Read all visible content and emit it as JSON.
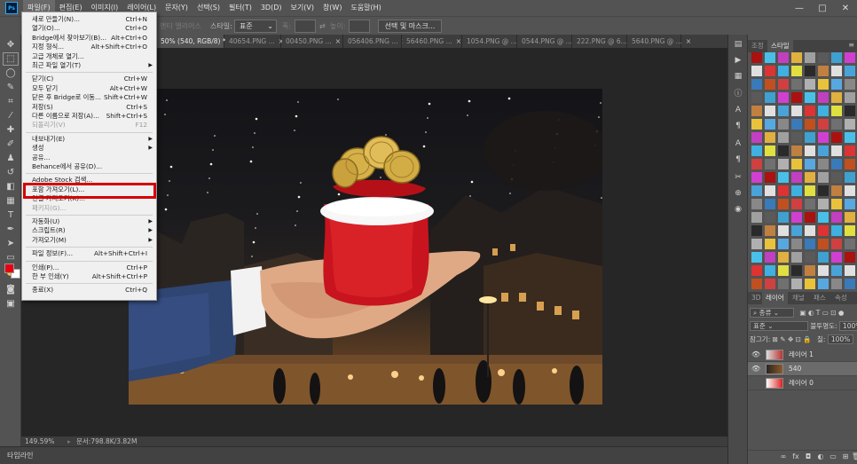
{
  "app": {
    "logo": "Ps",
    "menus": [
      "파일(F)",
      "편집(E)",
      "이미지(I)",
      "레이어(L)",
      "문자(Y)",
      "선택(S)",
      "필터(T)",
      "3D(D)",
      "보기(V)",
      "창(W)",
      "도움말(H)"
    ],
    "active_menu": "파일(F)",
    "window_controls": [
      "—",
      "□",
      "✕"
    ]
  },
  "options_bar": {
    "select_and_mask": "선택 및 마스크...",
    "style_label": "스타일:",
    "style_value": "표준",
    "width_label": "폭:",
    "height_label": "높이:",
    "antialias": "앤티 앨리어스"
  },
  "document_tabs": [
    {
      "label": "50% (540, RGB/8) *",
      "active": true
    },
    {
      "label": "40654.PNG ...",
      "active": false
    },
    {
      "label": "00450.PNG ...",
      "active": false
    },
    {
      "label": "056406.PNG ...",
      "active": false
    },
    {
      "label": "56460.PNG ...",
      "active": false
    },
    {
      "label": "1054.PNG @ ...",
      "active": false
    },
    {
      "label": "0544.PNG @ ...",
      "active": false
    },
    {
      "label": "222.PNG @ 6...",
      "active": false
    },
    {
      "label": "5640.PNG @ ...",
      "active": false
    }
  ],
  "file_menu": {
    "items": [
      {
        "label": "새로 만들기(N)...",
        "shortcut": "Ctrl+N"
      },
      {
        "label": "열기(O)...",
        "shortcut": "Ctrl+O"
      },
      {
        "label": "Bridge에서 찾아보기(B)...",
        "shortcut": "Alt+Ctrl+O"
      },
      {
        "label": "지정 형식...",
        "shortcut": "Alt+Shift+Ctrl+O"
      },
      {
        "label": "고급 개체로 열기...",
        "shortcut": ""
      },
      {
        "label": "최근 파일 열기(T)",
        "shortcut": "",
        "submenu": true
      },
      {
        "separator": true
      },
      {
        "label": "닫기(C)",
        "shortcut": "Ctrl+W"
      },
      {
        "label": "모두 닫기",
        "shortcut": "Alt+Ctrl+W"
      },
      {
        "label": "닫은 후 Bridge로 이동...",
        "shortcut": "Shift+Ctrl+W"
      },
      {
        "label": "저장(S)",
        "shortcut": "Ctrl+S"
      },
      {
        "label": "다른 이름으로 저장(A)...",
        "shortcut": "Shift+Ctrl+S"
      },
      {
        "label": "되돌리기(V)",
        "shortcut": "F12",
        "disabled": true
      },
      {
        "separator": true
      },
      {
        "label": "내보내기(E)",
        "shortcut": "",
        "submenu": true
      },
      {
        "label": "생성",
        "shortcut": "",
        "submenu": true
      },
      {
        "label": "공유...",
        "shortcut": ""
      },
      {
        "label": "Behance에서 공유(D)...",
        "shortcut": ""
      },
      {
        "separator": true
      },
      {
        "label": "Adobe Stock 검색...",
        "shortcut": ""
      },
      {
        "label": "포함 가져오기(L)...",
        "shortcut": "",
        "highlighted": true
      },
      {
        "label": "연결 가져오기(K)...",
        "shortcut": ""
      },
      {
        "label": "패키지(G)...",
        "shortcut": "",
        "disabled": true
      },
      {
        "separator": true
      },
      {
        "label": "자동화(U)",
        "shortcut": "",
        "submenu": true
      },
      {
        "label": "스크립트(R)",
        "shortcut": "",
        "submenu": true
      },
      {
        "label": "가져오기(M)",
        "shortcut": "",
        "submenu": true
      },
      {
        "separator": true
      },
      {
        "label": "파일 정보(F)...",
        "shortcut": "Alt+Shift+Ctrl+I"
      },
      {
        "separator": true
      },
      {
        "label": "인쇄(P)...",
        "shortcut": "Ctrl+P"
      },
      {
        "label": "한 부 인쇄(Y)",
        "shortcut": "Alt+Shift+Ctrl+P"
      },
      {
        "separator": true
      },
      {
        "label": "종료(X)",
        "shortcut": "Ctrl+Q"
      }
    ]
  },
  "status": {
    "zoom": "149.59%",
    "doc_info": "문서:798.8K/3.82M"
  },
  "timeline": {
    "label": "타임라인"
  },
  "styles_panel": {
    "tabs": [
      "조정",
      "스타일"
    ],
    "active_tab": "스타일"
  },
  "layers_panel": {
    "tabs": [
      "3D",
      "레이어",
      "채널",
      "패스",
      "속성"
    ],
    "active_tab": "레이어",
    "filter_kind": "종류",
    "blend_mode": "표준",
    "opacity_label": "불투명도:",
    "opacity_value": "100%",
    "lock_label": "잠그기:",
    "fill_label": "칠:",
    "fill_value": "100%",
    "layers": [
      {
        "name": "레이어 1",
        "visible": true,
        "selected": false
      },
      {
        "name": "540",
        "visible": true,
        "selected": true
      },
      {
        "name": "레이어 0",
        "visible": false,
        "selected": false
      }
    ],
    "footer_icons": [
      "∞",
      "fx",
      "◘",
      "◐",
      "▭",
      "⊞",
      "🗑"
    ]
  },
  "colors": {
    "foreground": "#e60012",
    "background": "#ffffff",
    "highlight_box": "#d40000"
  }
}
